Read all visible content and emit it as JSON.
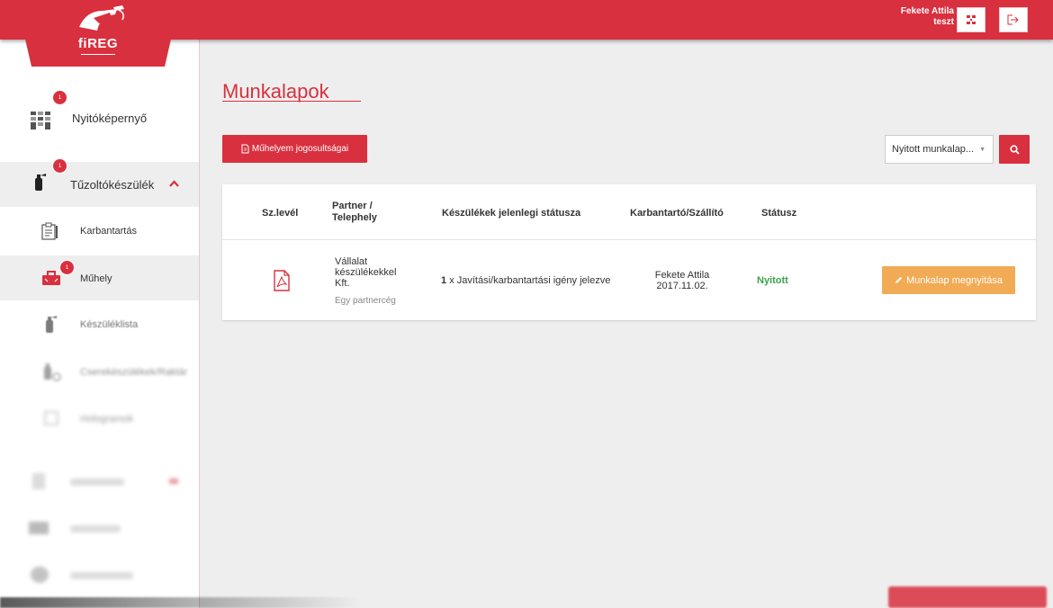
{
  "app": {
    "logo_text": "fiREG"
  },
  "header": {
    "user_name": "Fekete Attila",
    "user_sub": "teszt",
    "icons": [
      "sitemap-icon",
      "logout-icon"
    ]
  },
  "sidebar": {
    "items": [
      {
        "label": "Nyitóképernyő",
        "badge": "1",
        "icon": "grid-icon"
      },
      {
        "label": "Tűzoltókészülék",
        "badge": "1",
        "icon": "extinguisher-icon"
      },
      {
        "label": "Karbantartás",
        "icon": "clipboard-icon"
      },
      {
        "label": "Műhely",
        "badge": "1",
        "icon": "toolbox-icon"
      },
      {
        "label": "Készüléklista",
        "icon": "extinguisher-icon"
      },
      {
        "label": "Cserekészülékek/Raktár",
        "icon": "swap-icon"
      },
      {
        "label": "Hologramok",
        "icon": "square-icon"
      }
    ]
  },
  "main": {
    "title": "Munkalapok",
    "permissions_button": "Műhelyem jogosultságai",
    "filter_value": "Nyitott munkalap...",
    "table": {
      "headers": {
        "sz_level": "Sz.levél",
        "partner_1": "Partner /",
        "partner_2": "Telephely",
        "status_current": "Készülékek jelenlegi státusza",
        "maintainer": "Karbantartó/Szállító",
        "status": "Státusz"
      },
      "rows": [
        {
          "partner_line1": "Vállalat",
          "partner_line2": "készülékekkel",
          "partner_line3": "Kft.",
          "site": "Egy partnercég",
          "count": "1",
          "device_status": "x Javítási/karbantartási igény jelezve",
          "maintainer_name": "Fekete Attila",
          "maintainer_date": "2017.11.02.",
          "status": "Nyitott",
          "action": "Munkalap megnyitása"
        }
      ]
    }
  },
  "colors": {
    "brand": "#d9303f",
    "orange": "#f1ab55",
    "green": "#3aa54a"
  }
}
